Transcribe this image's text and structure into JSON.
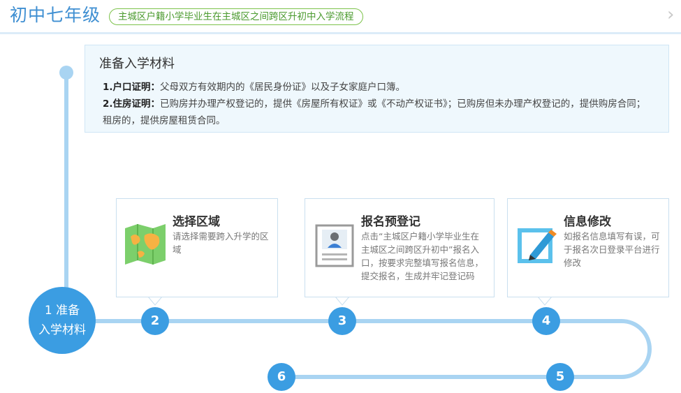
{
  "header": {
    "title": "初中七年级",
    "subtitle": "主城区户籍小学毕业生在主城区之间跨区升初中入学流程",
    "nav_icon": "chevron-right-icon"
  },
  "info": {
    "title": "准备入学材料",
    "items": [
      {
        "label": "1.户口证明：",
        "text": "父母双方有效期内的《居民身份证》以及子女家庭户口簿。"
      },
      {
        "label": "2.住房证明：",
        "text": "已购房并办理产权登记的，提供《房屋所有权证》或《不动产权证书》；已购房但未办理产权登记的，提供购房合同；租房的，提供房屋租赁合同。"
      }
    ]
  },
  "steps": {
    "step1_line1": "1 准备",
    "step1_line2": "入学材料",
    "n2": "2",
    "n3": "3",
    "n4": "4",
    "n5": "5",
    "n6": "6"
  },
  "cards": [
    {
      "icon": "map-icon",
      "title": "选择区域",
      "desc": "请选择需要跨入升学的区域"
    },
    {
      "icon": "id-card-icon",
      "title": "报名预登记",
      "desc": "点击“主城区户籍小学毕业生在主城区之间跨区升初中”报名入口，按要求完整填写报名信息，提交报名，生成并牢记登记码"
    },
    {
      "icon": "edit-icon",
      "title": "信息修改",
      "desc": "如报名信息填写有误，可于报名次日登录平台进行修改"
    }
  ],
  "colors": {
    "accent": "#3b9de2",
    "line": "#a9d4f2",
    "pill_border": "#7cc24a"
  }
}
